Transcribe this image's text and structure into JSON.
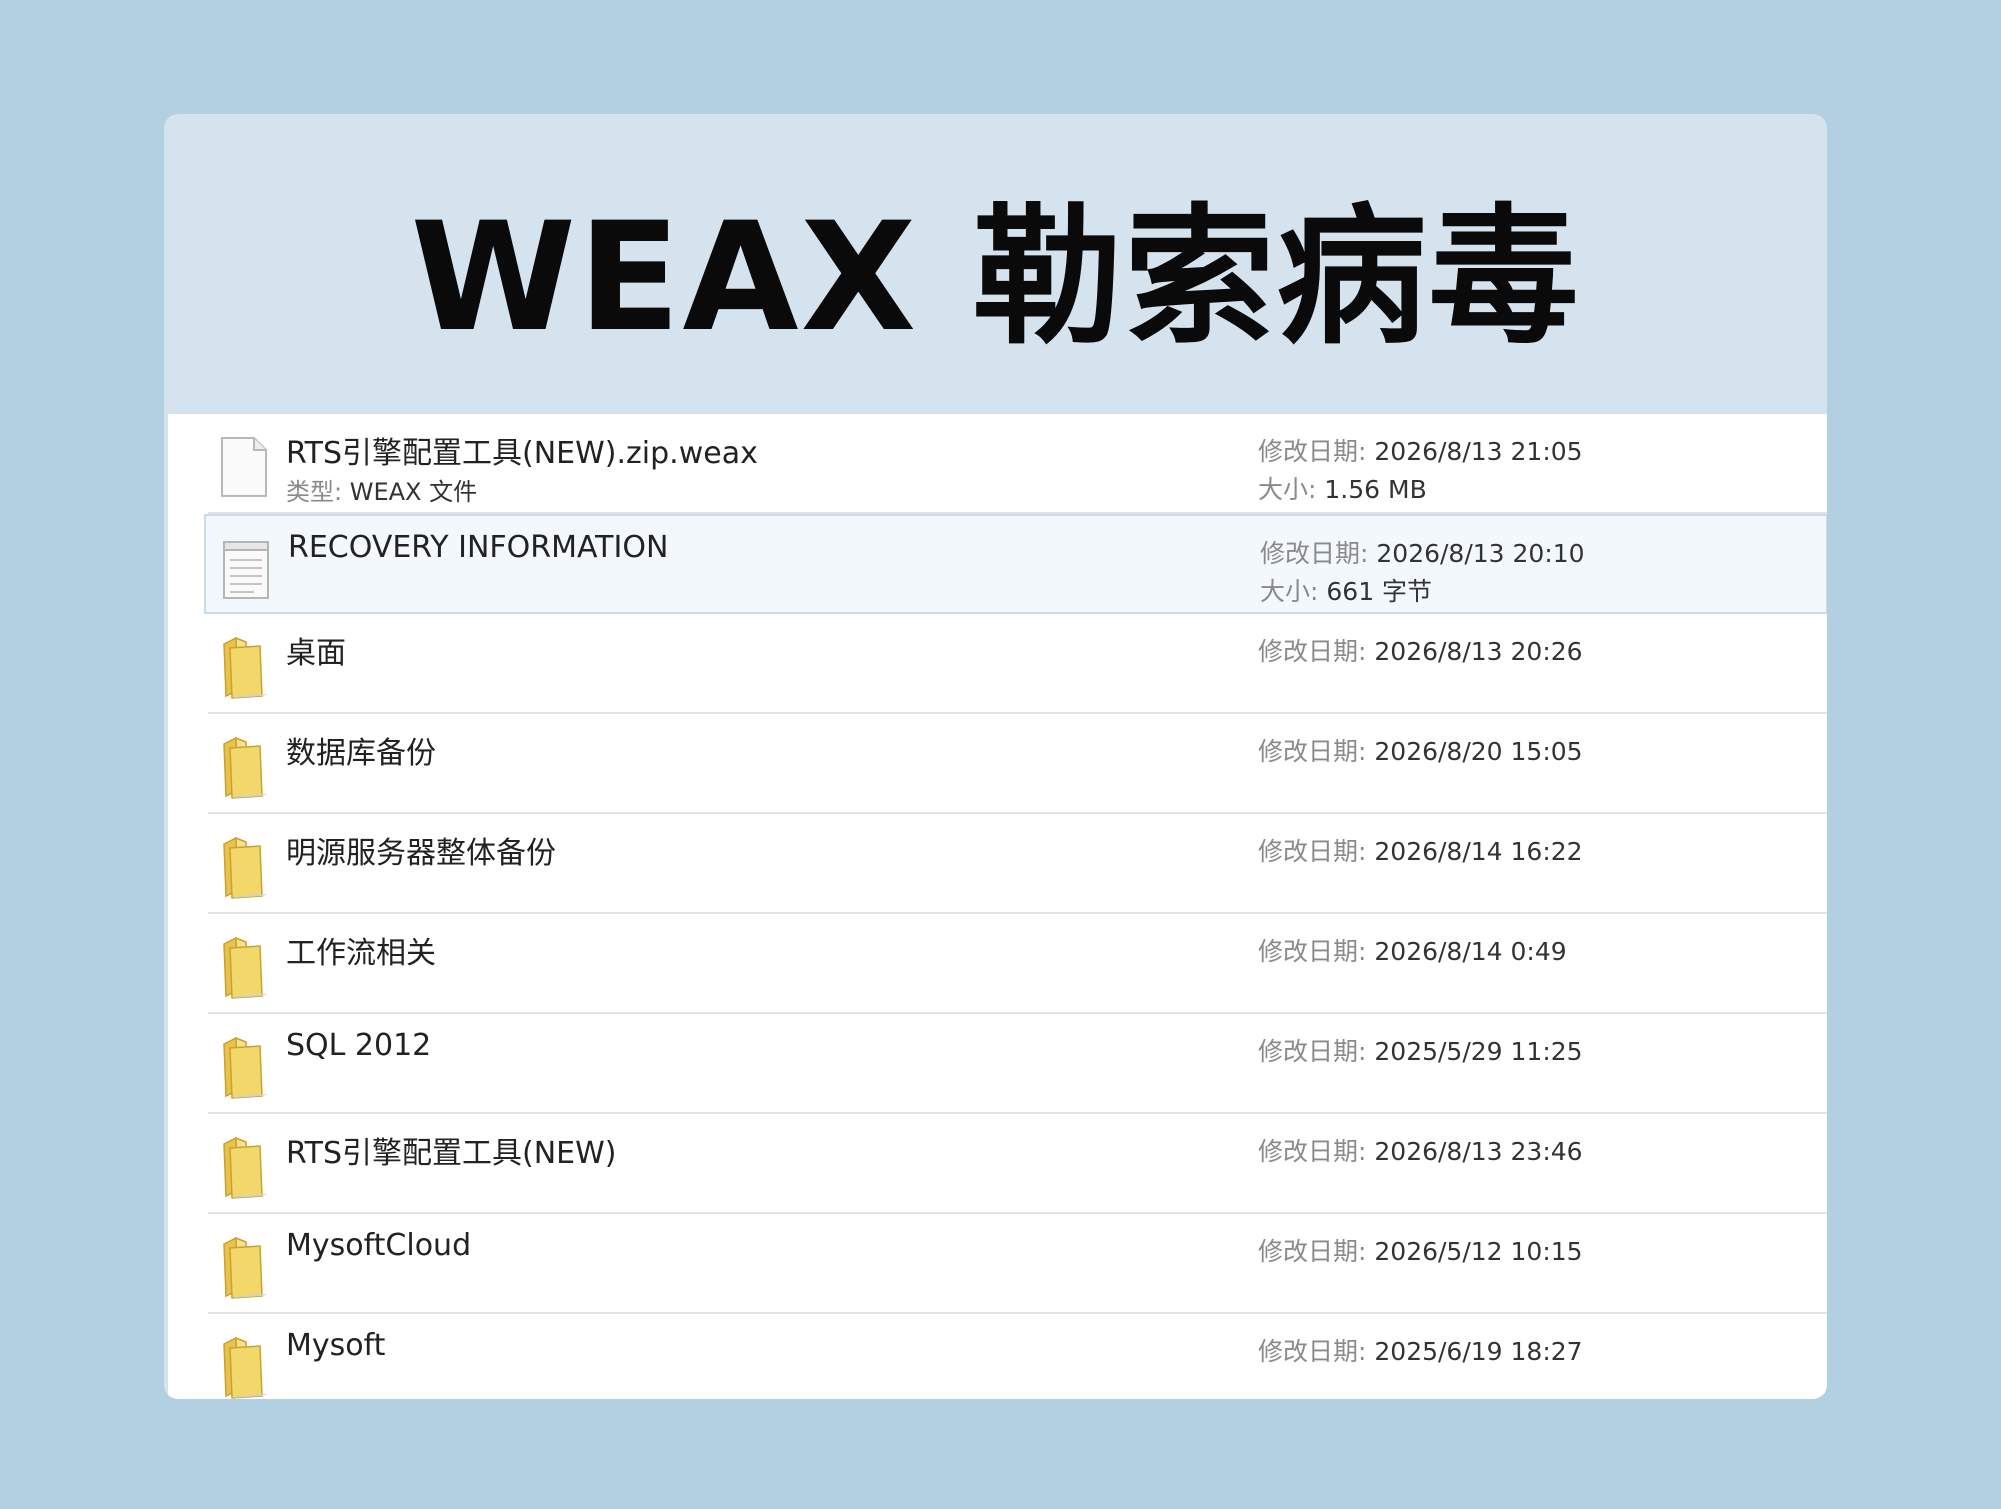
{
  "title": "WEAX 勒索病毒",
  "files": [
    {
      "name": "RTS引擎配置工具(NEW).zip.weax",
      "icon": "blank-file-icon",
      "type_label": "类型:",
      "type_value": "WEAX 文件",
      "date_label": "修改日期:",
      "date": "2026/8/13 21:05",
      "size_label": "大小:",
      "size": "1.56 MB"
    },
    {
      "name": "RECOVERY INFORMATION",
      "icon": "text-file-icon",
      "date_label": "修改日期:",
      "date": "2026/8/13 20:10",
      "size_label": "大小:",
      "size": "661 字节"
    },
    {
      "name": "桌面",
      "icon": "folder-icon",
      "date_label": "修改日期:",
      "date": "2026/8/13 20:26"
    },
    {
      "name": "数据库备份",
      "icon": "folder-icon",
      "date_label": "修改日期:",
      "date": "2026/8/20 15:05"
    },
    {
      "name": "明源服务器整体备份",
      "icon": "folder-icon",
      "date_label": "修改日期:",
      "date": "2026/8/14 16:22"
    },
    {
      "name": "工作流相关",
      "icon": "folder-icon",
      "date_label": "修改日期:",
      "date": "2026/8/14 0:49"
    },
    {
      "name": "SQL 2012",
      "icon": "folder-icon",
      "date_label": "修改日期:",
      "date": "2025/5/29 11:25"
    },
    {
      "name": "RTS引擎配置工具(NEW)",
      "icon": "folder-icon",
      "date_label": "修改日期:",
      "date": "2026/8/13 23:46"
    },
    {
      "name": "MysoftCloud",
      "icon": "folder-icon",
      "date_label": "修改日期:",
      "date": "2026/5/12 10:15"
    },
    {
      "name": "Mysoft",
      "icon": "folder-icon",
      "date_label": "修改日期:",
      "date": "2025/6/19 18:27"
    }
  ],
  "colors": {
    "page_bg": "#b3cfe2",
    "banner_bg": "#d5e3ee",
    "list_bg": "#ffffff",
    "folder": "#f2d76a",
    "selection": "#f3f8fd"
  }
}
